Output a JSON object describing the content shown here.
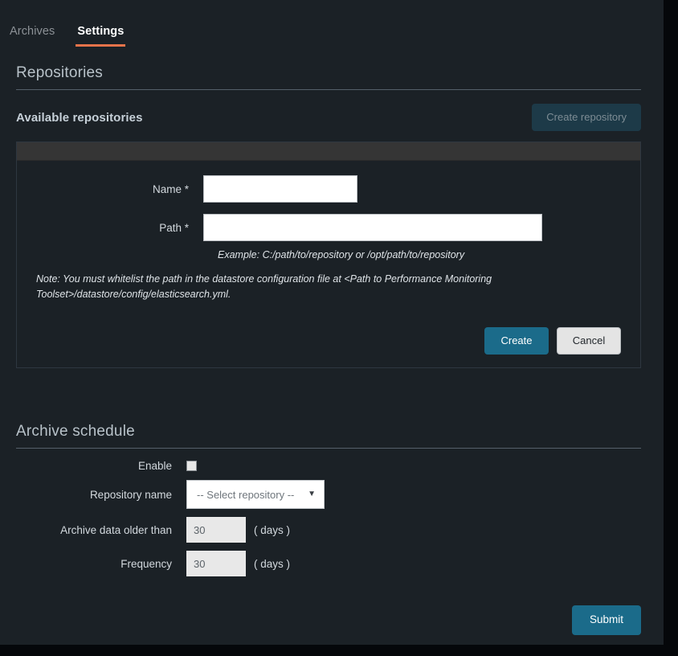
{
  "tabs": [
    {
      "label": "Archives",
      "active": false
    },
    {
      "label": "Settings",
      "active": true
    }
  ],
  "repositories": {
    "section_title": "Repositories",
    "subhead": "Available repositories",
    "create_repository_button": "Create repository",
    "form": {
      "name_label": "Name *",
      "name_value": "",
      "path_label": "Path *",
      "path_value": "",
      "example_hint": "Example: C:/path/to/repository or /opt/path/to/repository",
      "note": "Note: You must whitelist the path in the datastore configuration file at <Path to Performance Monitoring Toolset>/datastore/config/elasticsearch.yml.",
      "create_button": "Create",
      "cancel_button": "Cancel"
    }
  },
  "archive_schedule": {
    "section_title": "Archive schedule",
    "enable_label": "Enable",
    "enable_checked": false,
    "repository_name_label": "Repository name",
    "repository_select_value": "-- Select repository --",
    "caret_glyph": "▼",
    "archive_older_label": "Archive data older than",
    "archive_older_value": "30",
    "archive_older_unit": "( days )",
    "frequency_label": "Frequency",
    "frequency_value": "30",
    "frequency_unit": "( days )",
    "submit_button": "Submit"
  },
  "colors": {
    "background": "#1b2126",
    "accent_tab": "#e8734a",
    "primary_button": "#1b6b8a",
    "disabled_button": "#1d3a48",
    "panel_header": "#353535"
  }
}
